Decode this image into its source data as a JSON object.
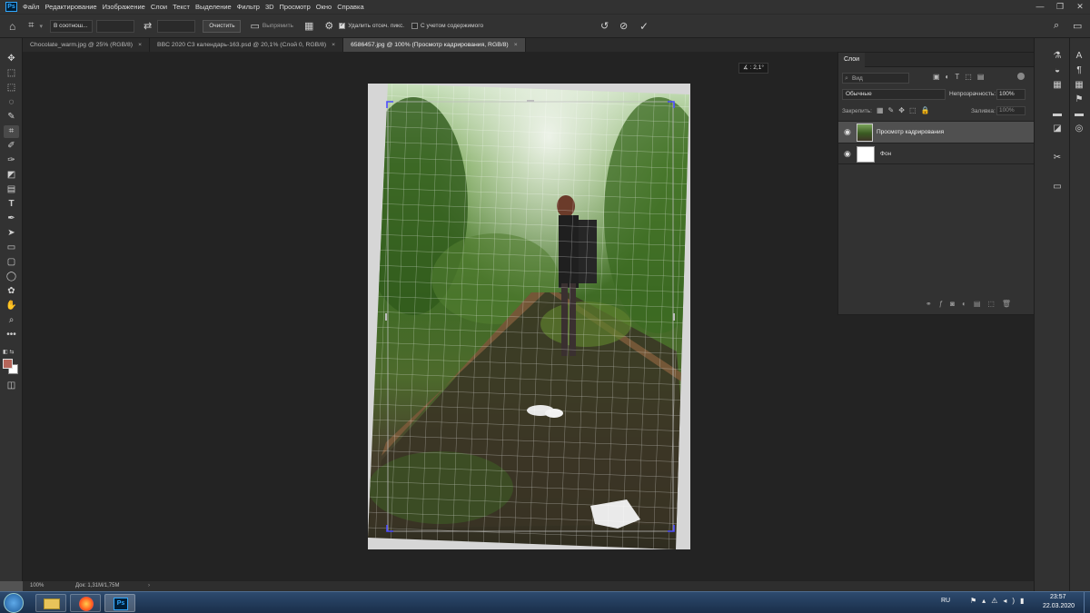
{
  "app": {
    "logo": "Ps"
  },
  "menu": [
    "Файл",
    "Редактирование",
    "Изображение",
    "Слои",
    "Текст",
    "Выделение",
    "Фильтр",
    "3D",
    "Просмотр",
    "Окно",
    "Справка"
  ],
  "options": {
    "ratio_select": "В соотнош...",
    "clear_button": "Очистить",
    "straighten_label": "Выпрямить",
    "delete_pixels_label": "Удалить отсеч. пикс.",
    "content_aware_label": "С учетом содержимого"
  },
  "tabs": [
    {
      "label": "Chocolate_warm.jpg @ 25% (RGB/8)"
    },
    {
      "label": "BBC 2020 C3 календарь-163.psd @ 20,1% (Слой 0, RGB/8)"
    },
    {
      "label": "6586457.jpg @ 100% (Просмотр кадрирования, RGB/8)"
    }
  ],
  "angle_readout": "∡ : 2,1°",
  "layers_panel": {
    "title": "Слои",
    "filter_placeholder": "Вид",
    "blend_mode": "Обычные",
    "opacity_label": "Непрозрачность:",
    "opacity_value": "100%",
    "lock_label": "Закрепить:",
    "fill_label": "Заливка:",
    "fill_value": "100%",
    "layers": [
      {
        "name": "Просмотр кадрирования"
      },
      {
        "name": "Фон"
      }
    ]
  },
  "status": {
    "zoom": "100%",
    "doc": "Док: 1,31M/1,75M"
  },
  "taskbar": {
    "lang": "RU",
    "time": "23:57",
    "date": "22.03.2020"
  },
  "colors": {
    "foreground": "#b5655a",
    "background": "#ffffff",
    "accent": "#31a8ff"
  }
}
